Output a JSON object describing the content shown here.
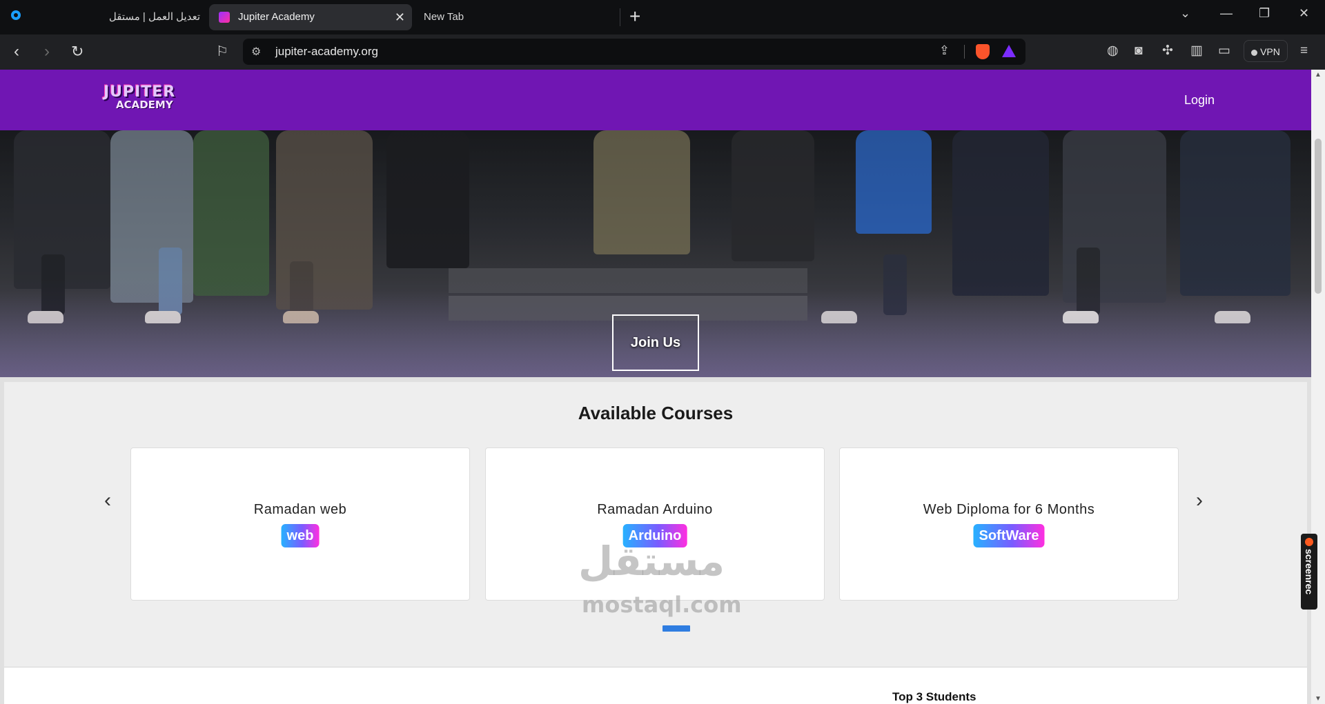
{
  "browser": {
    "tabs": [
      {
        "title": "تعديل العمل | مستقل"
      },
      {
        "title": "Jupiter Academy"
      },
      {
        "title": "New Tab"
      }
    ],
    "url": "jupiter-academy.org",
    "vpn_label": "VPN"
  },
  "site": {
    "logo": {
      "line1": "JUPITER",
      "line2": "ACADEMY"
    },
    "login_label": "Login",
    "hero": {
      "cta_label": "Join Us"
    },
    "courses": {
      "title": "Available Courses",
      "items": [
        {
          "name": "Ramadan web",
          "category": "web"
        },
        {
          "name": "Ramadan Arduino",
          "category": "Arduino"
        },
        {
          "name": "Web Diploma for 6 Months",
          "category": "SoftWare"
        }
      ]
    },
    "students": {
      "title": "Top 3 Students"
    }
  },
  "watermark": {
    "arabic": "مستقل",
    "latin": "mostaql.com"
  },
  "screenrec": {
    "label": "screenrec"
  },
  "colors": {
    "nav": "#7016b3",
    "accent": "#2f7de1",
    "badge_start": "#27b1ff",
    "badge_end": "#ff2fe0"
  }
}
